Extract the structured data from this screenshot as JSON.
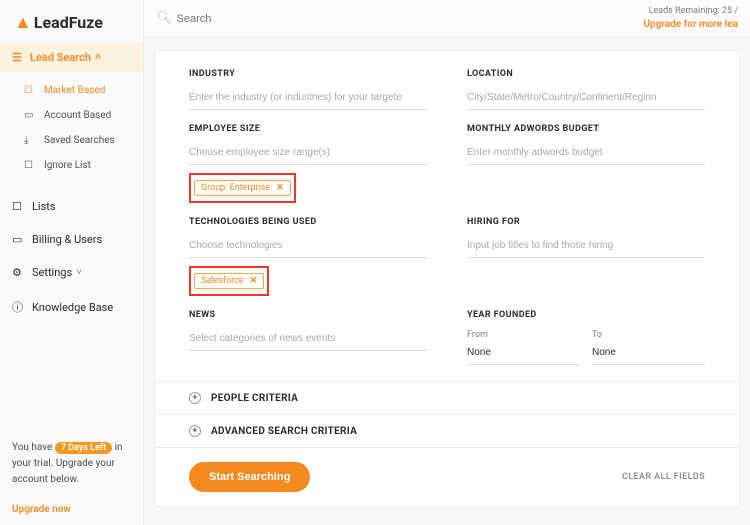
{
  "logo": {
    "brand": "LeadFuze"
  },
  "sidebar": {
    "leadSearch": {
      "head": "Lead Search",
      "items": [
        {
          "label": "Market Based",
          "active": true
        },
        {
          "label": "Account Based",
          "active": false
        },
        {
          "label": "Saved Searches",
          "active": false
        },
        {
          "label": "Ignore List",
          "active": false
        }
      ]
    },
    "mainItems": [
      {
        "label": "Lists"
      },
      {
        "label": "Billing & Users"
      },
      {
        "label": "Settings",
        "hasChevron": true
      },
      {
        "label": "Knowledge Base"
      }
    ],
    "trial": {
      "prefix": "You have ",
      "badge": "7 Days Left",
      "suffix": " in your trial. Upgrade your account below.",
      "cta": "Upgrade now"
    }
  },
  "topbar": {
    "searchPlaceholder": "Search",
    "leadsRemaining": "Leads Remaining: 25 /",
    "upgradeMore": "Upgrade for more lea"
  },
  "form": {
    "industry": {
      "label": "INDUSTRY",
      "placeholder": "Enter the industry (or industries) for your targete"
    },
    "location": {
      "label": "LOCATION",
      "placeholder": "City/State/Metro/Country/Continent/Region"
    },
    "employeeSize": {
      "label": "EMPLOYEE SIZE",
      "placeholder": "Choose employee size range(s)",
      "chip": "Group: Enterprise"
    },
    "adwords": {
      "label": "MONTHLY ADWORDS BUDGET",
      "placeholder": "Enter monthly adwords budget"
    },
    "technologies": {
      "label": "TECHNOLOGIES BEING USED",
      "placeholder": "Choose technologies",
      "chip": "Salesforce"
    },
    "hiring": {
      "label": "HIRING FOR",
      "placeholder": "Input job titles to find those hiring"
    },
    "news": {
      "label": "NEWS",
      "placeholder": "Select categories of news events"
    },
    "yearFounded": {
      "label": "YEAR FOUNDED",
      "fromLabel": "From",
      "toLabel": "To",
      "fromValue": "None",
      "toValue": "None"
    },
    "accordions": {
      "people": "PEOPLE CRITERIA",
      "advanced": "ADVANCED SEARCH CRITERIA"
    },
    "actions": {
      "start": "Start Searching",
      "clear": "CLEAR ALL FIELDS"
    }
  }
}
